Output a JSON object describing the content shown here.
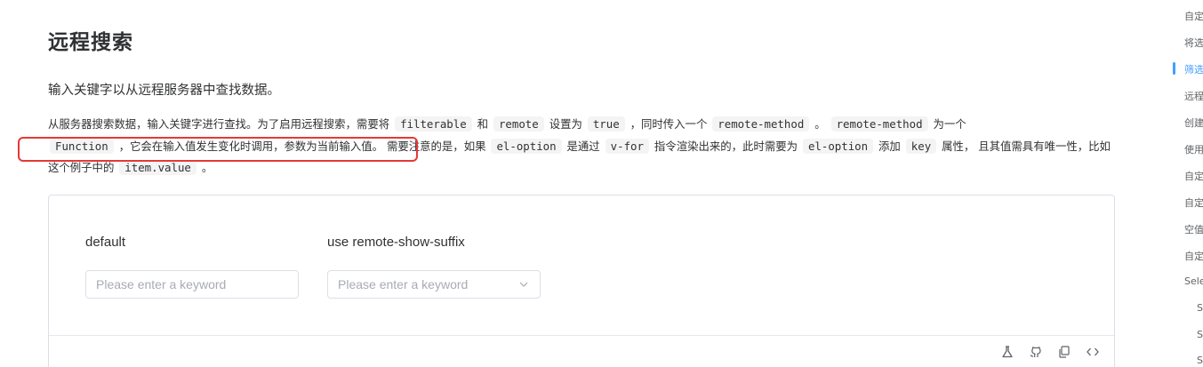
{
  "page": {
    "title": "远程搜索",
    "lead": "输入关键字以从远程服务器中查找数据。"
  },
  "description": {
    "p1": "从服务器搜索数据，输入关键字进行查找。为了启用远程搜索，需要将",
    "code_filterable": "filterable",
    "and": "和",
    "code_remote": "remote",
    "p2": "设置为",
    "code_true": "true",
    "p3": "，同时传入一个",
    "code_remote_method": "remote-method",
    "p4": "。",
    "code_remote_method_2": "remote-method",
    "p5": "为一个",
    "code_function": "Function",
    "p6": "，它会在输入值发生变化时调用，参数为当前输入值。",
    "p7": "需要注意的是，如果",
    "code_el_option": "el-option",
    "p8": "是通过",
    "code_v_for": "v-for",
    "p9": "指令渲染出来的，此时需要为",
    "code_el_option_2": "el-option",
    "p10": "添加",
    "code_key": "key",
    "p11": "属性， 且其值需具有唯一性，比如这个例子中的",
    "code_item_value": "item.value",
    "p12": "。"
  },
  "demo": {
    "default_label": "default",
    "suffix_label": "use remote-show-suffix",
    "placeholder": "Please enter a keyword"
  },
  "toc": {
    "items": [
      {
        "label": "自定",
        "active": false
      },
      {
        "label": "将选",
        "active": false
      },
      {
        "label": "筛选",
        "active": true
      },
      {
        "label": "远程",
        "active": false
      },
      {
        "label": "创建",
        "active": false
      },
      {
        "label": "使用",
        "active": false
      },
      {
        "label": "自定",
        "active": false
      },
      {
        "label": "自定",
        "active": false
      },
      {
        "label": "空值",
        "active": false
      },
      {
        "label": "自定",
        "active": false
      },
      {
        "label": "Sele",
        "active": false
      },
      {
        "label": "S",
        "active": false
      },
      {
        "label": "S",
        "active": false
      },
      {
        "label": "S",
        "active": false
      }
    ]
  },
  "colors": {
    "accent": "#409eff",
    "annotation": "#e53935"
  },
  "icons": [
    "flask-icon",
    "github-icon",
    "copy-icon",
    "code-icon",
    "chevron-down-icon"
  ]
}
